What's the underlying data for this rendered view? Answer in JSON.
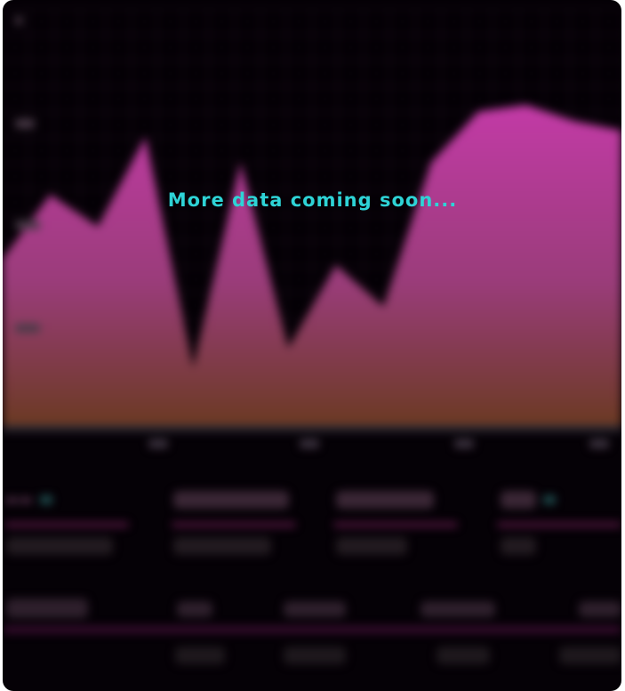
{
  "overlay": {
    "message": "More data coming soon..."
  },
  "colors": {
    "background": "#050106",
    "overlay_text": "#2ed3d6",
    "area_top": "#c23aa6",
    "area_bottom": "#6b3a23",
    "accent_line": "#52163f"
  },
  "chart_data": {
    "type": "area",
    "x": [
      0,
      1,
      2,
      3,
      4,
      5,
      6,
      7,
      8,
      9,
      10,
      11,
      12,
      13
    ],
    "values": [
      52,
      72,
      62,
      90,
      18,
      82,
      24,
      50,
      37,
      82,
      98,
      100,
      95,
      92
    ],
    "ylim": [
      0,
      130
    ],
    "grid": true
  }
}
